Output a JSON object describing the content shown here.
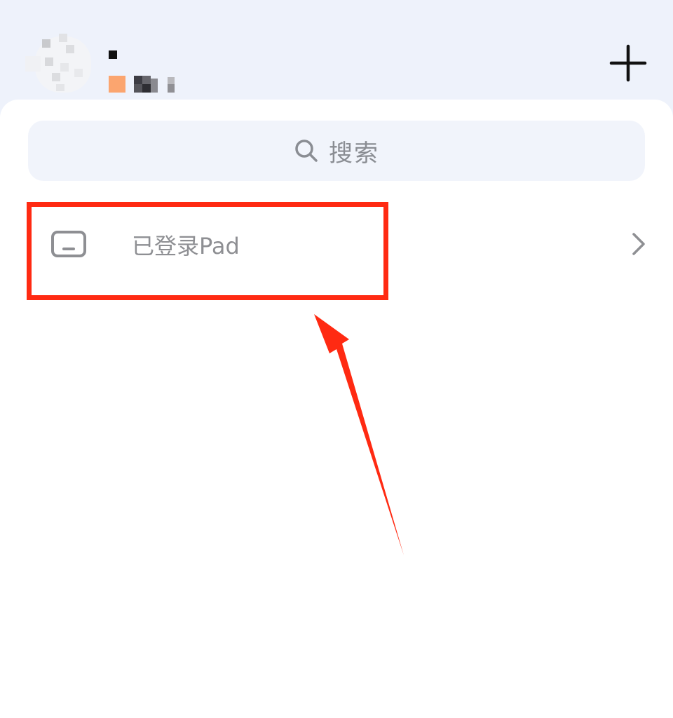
{
  "header": {
    "avatar_icon": "avatar-placeholder",
    "add_icon": "plus-icon"
  },
  "search": {
    "placeholder": "搜索",
    "icon": "search-icon"
  },
  "devices": {
    "pad_row": {
      "label": "已登录Pad",
      "icon": "tablet-icon",
      "chevron_icon": "chevron-right-icon"
    }
  },
  "annotation": {
    "highlight_color": "#ff2a12",
    "arrow_color": "#ff2a12"
  },
  "colors": {
    "header_bg": "#eef2fb",
    "sheet_bg": "#ffffff",
    "search_bg": "#f1f4fb",
    "muted_text": "#8e8f93"
  }
}
